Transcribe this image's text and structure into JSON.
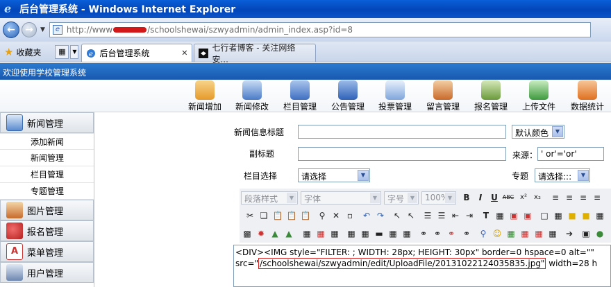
{
  "window": {
    "title": "后台管理系统 - Windows Internet Explorer"
  },
  "address": {
    "prefix": "http://www",
    "suffix": "/schoolshewai/szwyadmin/admin_index.asp?id=8"
  },
  "favorites": {
    "label": "收藏夹"
  },
  "tabs": [
    {
      "label": "后台管理系统",
      "active": true
    },
    {
      "label": "七行者博客 - 关注网络安...",
      "active": false
    }
  ],
  "welcome": "欢迎使用学校管理系统",
  "toolbar": [
    {
      "label": "新闻增加",
      "icon": "news-add-icon",
      "color": "#e69a2a"
    },
    {
      "label": "新闻修改",
      "icon": "news-edit-icon",
      "color": "#4a7bc8"
    },
    {
      "label": "栏目管理",
      "icon": "column-icon",
      "color": "#3f6fc2"
    },
    {
      "label": "公告管理",
      "icon": "notice-icon",
      "color": "#2f62b8"
    },
    {
      "label": "投票管理",
      "icon": "vote-icon",
      "color": "#7fa6dc"
    },
    {
      "label": "留言管理",
      "icon": "message-icon",
      "color": "#c96a2a"
    },
    {
      "label": "报名管理",
      "icon": "signup-icon",
      "color": "#6b9a3c"
    },
    {
      "label": "上传文件",
      "icon": "upload-icon",
      "color": "#3e9a3e"
    },
    {
      "label": "数据统计",
      "icon": "stats-icon",
      "color": "#e07020"
    }
  ],
  "sidebar": {
    "news_head": "新闻管理",
    "news_items": [
      "添加新闻",
      "新闻管理",
      "栏目管理",
      "专题管理"
    ],
    "sections": [
      "图片管理",
      "报名管理",
      "菜单管理",
      "用户管理"
    ]
  },
  "form": {
    "title_label": "新闻信息标题",
    "title_value": "",
    "color_select": "默认颜色",
    "subtitle_label": "副标题",
    "subtitle_value": "",
    "source_label": "来源：",
    "source_value": "' or'='or'",
    "column_label": "栏目选择",
    "column_select": "请选择",
    "topic_label": "专题",
    "topic_select": "请选择:::"
  },
  "editor": {
    "style_select": "段落样式",
    "font_select": "字体",
    "size_select": "字号",
    "zoom_select": "100%",
    "bold": "B",
    "italic": "I",
    "underline": "U",
    "strike": "ABC",
    "sup": "x²",
    "sub": "x₂",
    "content_line1": "<DIV><IMG style=\"FILTER: ; WIDTH: 28px; HEIGHT: 30px\" border=0 hspace=0 alt=\"\"",
    "content_line2_pre": "src=\"",
    "content_line2_hl": "/schoolshewai/szwyadmin/edit/UploadFile/20131022124035835.jpg\"",
    "content_line2_post": " width=28 h"
  }
}
